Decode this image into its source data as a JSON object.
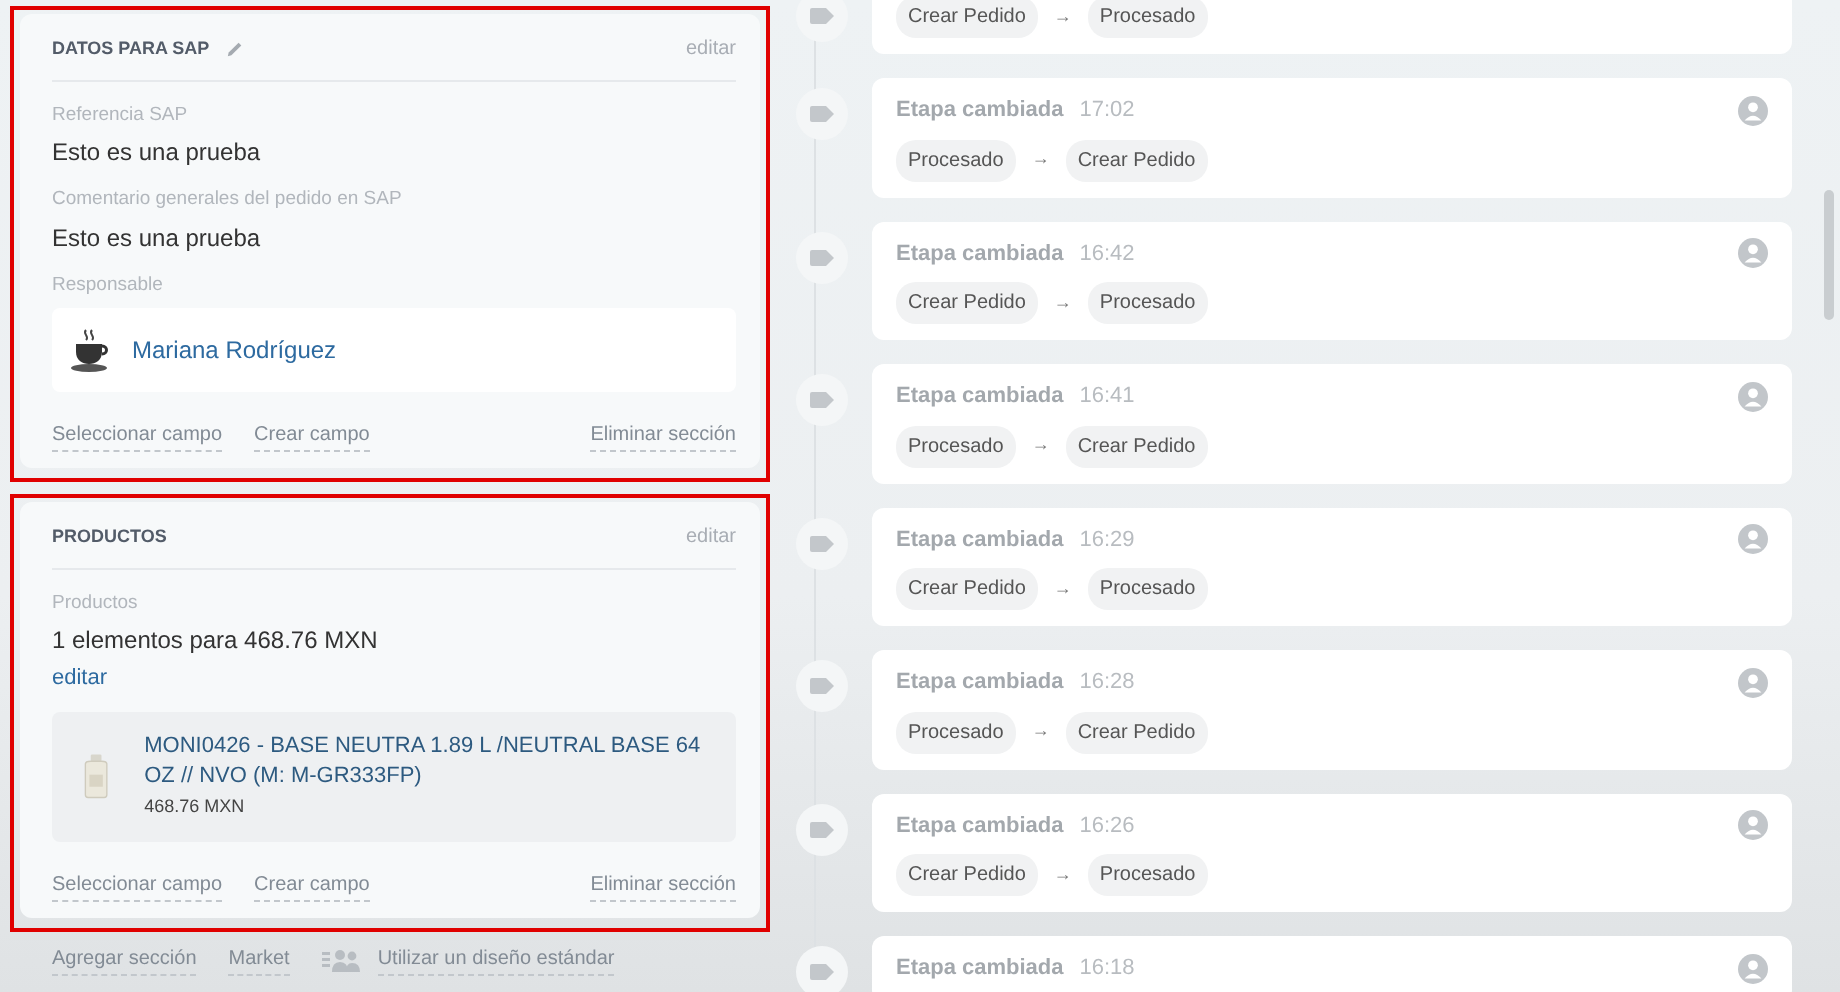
{
  "sections": [
    {
      "title": "DATOS PARA SAP",
      "title_edit_icon": true,
      "edit": "editar",
      "highlighted": true,
      "fields": [
        {
          "kind": "text",
          "label": "Referencia SAP",
          "value": "Esto es una prueba"
        },
        {
          "kind": "text",
          "label": "Comentario generales del pedido en SAP",
          "value": "Esto es una prueba"
        },
        {
          "kind": "user",
          "label": "Responsable",
          "value": "Mariana Rodríguez"
        }
      ],
      "footer_links": [
        "Seleccionar campo",
        "Crear campo"
      ],
      "delete": "Eliminar sección"
    },
    {
      "title": "PRODUCTOS",
      "title_edit_icon": false,
      "edit": "editar",
      "highlighted": true,
      "fields": [
        {
          "kind": "products",
          "label": "Productos",
          "value": "1 elementos para 468.76 MXN",
          "edit": "editar",
          "items": [
            {
              "name": "MONI0426 - BASE NEUTRA 1.89 L /NEUTRAL BASE 64 OZ // NVO (M: M-GR333FP)",
              "price": "468.76 MXN"
            }
          ]
        }
      ],
      "footer_links": [
        "Seleccionar campo",
        "Crear campo"
      ],
      "delete": "Eliminar sección"
    }
  ],
  "bottom_links": [
    "Agregar sección",
    "Market"
  ],
  "standard_design": "Utilizar un diseño estándar",
  "timeline": [
    {
      "stages": [
        "Crear Pedido",
        "Procesado"
      ],
      "arrow": "→"
    },
    {
      "title": "Etapa cambiada",
      "time": "17:02",
      "stages": [
        "Procesado",
        "Crear Pedido"
      ],
      "arrow": "→"
    },
    {
      "title": "Etapa cambiada",
      "time": "16:42",
      "stages": [
        "Crear Pedido",
        "Procesado"
      ],
      "arrow": "→"
    },
    {
      "title": "Etapa cambiada",
      "time": "16:41",
      "stages": [
        "Procesado",
        "Crear Pedido"
      ],
      "arrow": "→"
    },
    {
      "title": "Etapa cambiada",
      "time": "16:29",
      "stages": [
        "Crear Pedido",
        "Procesado"
      ],
      "arrow": "→"
    },
    {
      "title": "Etapa cambiada",
      "time": "16:28",
      "stages": [
        "Procesado",
        "Crear Pedido"
      ],
      "arrow": "→"
    },
    {
      "title": "Etapa cambiada",
      "time": "16:26",
      "stages": [
        "Crear Pedido",
        "Procesado"
      ],
      "arrow": "→"
    },
    {
      "title": "Etapa cambiada",
      "time": "16:18"
    }
  ]
}
